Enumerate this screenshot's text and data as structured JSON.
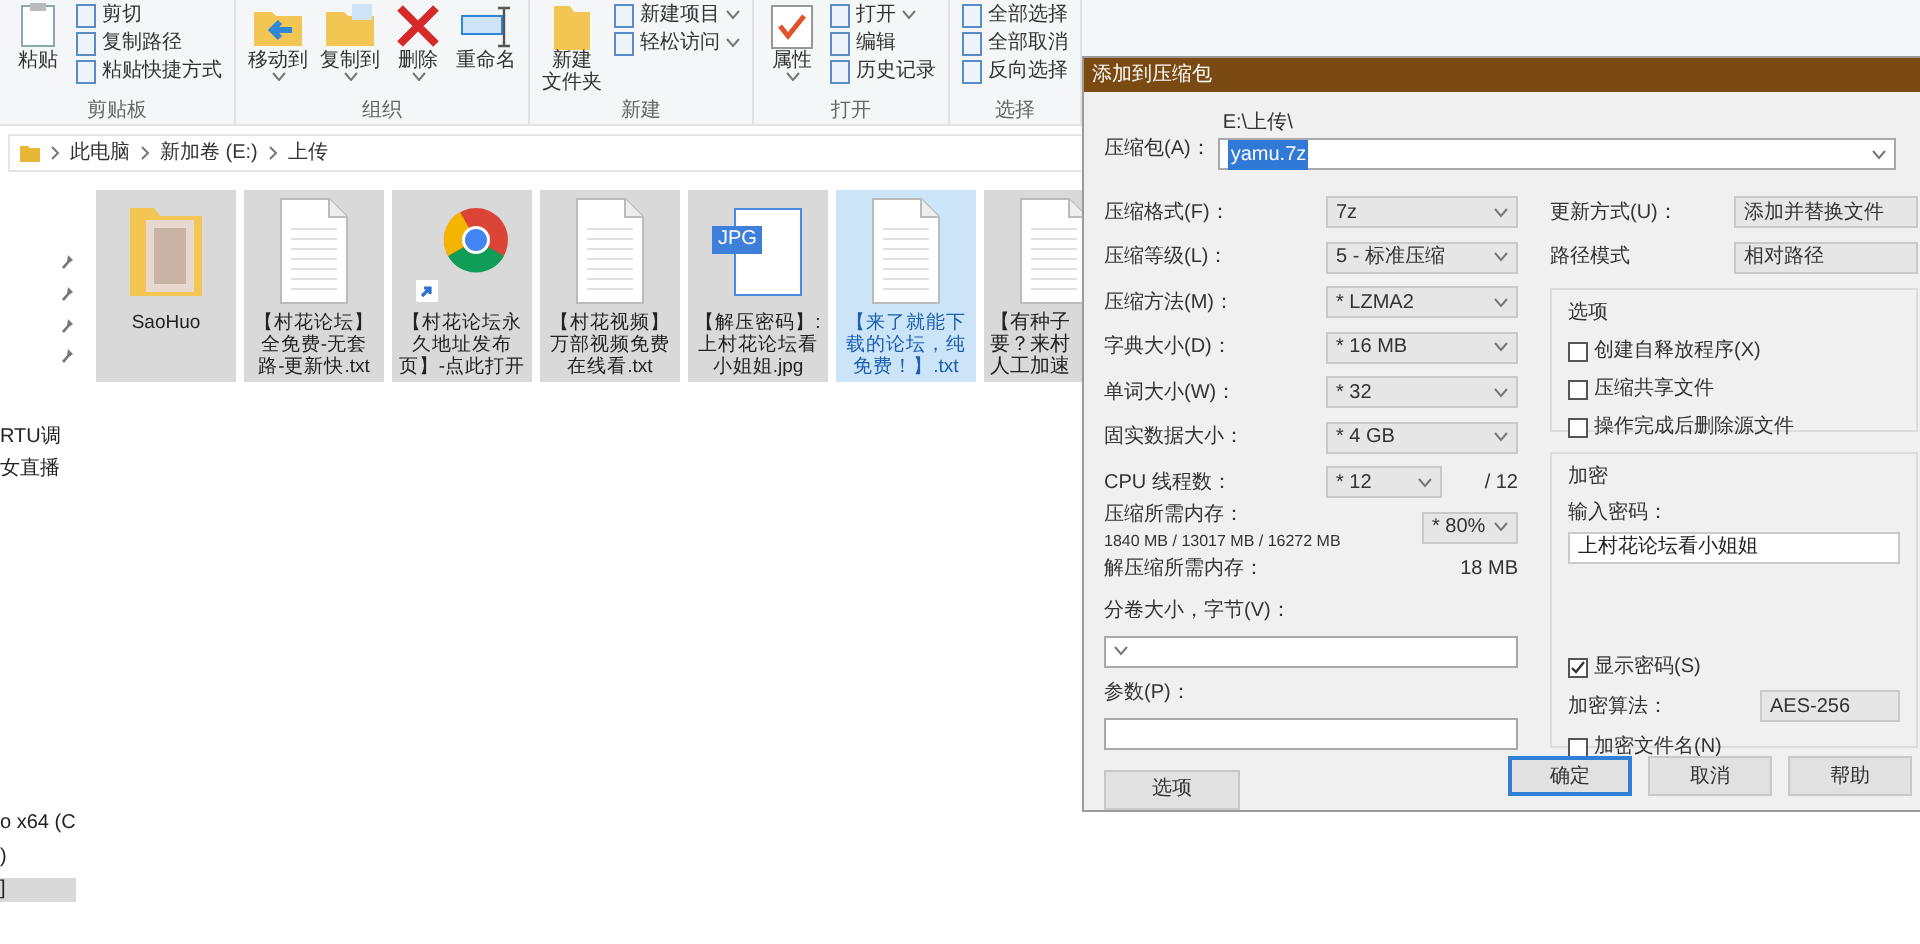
{
  "ribbon": {
    "groups": [
      {
        "label": "剪贴板",
        "items": [
          {
            "label": "粘贴",
            "kind": "large",
            "dropdown": false
          },
          {
            "label": "剪切",
            "kind": "small",
            "dropdown": false
          },
          {
            "label": "复制路径",
            "kind": "small",
            "dropdown": false
          },
          {
            "label": "粘贴快捷方式",
            "kind": "small",
            "dropdown": false
          }
        ]
      },
      {
        "label": "组织",
        "items": [
          {
            "label": "移动到",
            "kind": "large",
            "dropdown": true
          },
          {
            "label": "复制到",
            "kind": "large",
            "dropdown": true
          },
          {
            "label": "删除",
            "kind": "large",
            "dropdown": true
          },
          {
            "label": "重命名",
            "kind": "large",
            "dropdown": false
          }
        ]
      },
      {
        "label": "新建",
        "items": [
          {
            "lines": [
              "新建",
              "文件夹"
            ],
            "kind": "large",
            "dropdown": false
          },
          {
            "label": "新建项目",
            "kind": "small",
            "dropdown": true
          },
          {
            "label": "轻松访问",
            "kind": "small",
            "dropdown": true
          }
        ]
      },
      {
        "label": "打开",
        "items": [
          {
            "label": "属性",
            "kind": "large",
            "dropdown": true
          },
          {
            "label": "打开",
            "kind": "small",
            "dropdown": true
          },
          {
            "label": "编辑",
            "kind": "small",
            "dropdown": false
          },
          {
            "label": "历史记录",
            "kind": "small",
            "dropdown": false
          }
        ]
      },
      {
        "label": "选择",
        "items": [
          {
            "label": "全部选择",
            "kind": "small",
            "dropdown": false
          },
          {
            "label": "全部取消",
            "kind": "small",
            "dropdown": false
          },
          {
            "label": "反向选择",
            "kind": "small",
            "dropdown": false
          }
        ]
      }
    ]
  },
  "breadcrumb": [
    "此电脑",
    "新加卷 (E:)",
    "上传"
  ],
  "nav_items": [
    {
      "label": "RTU调",
      "selected": false
    },
    {
      "label": "女直播",
      "selected": false
    },
    {
      "label": "o x64 (C",
      "selected": false
    },
    {
      "label": ")",
      "selected": false
    },
    {
      "label": "]",
      "selected": true
    }
  ],
  "files": [
    {
      "name": "SaoHuo",
      "kind": "folder",
      "selected": false
    },
    {
      "name": "【村花论坛】全免费-无套路-更新快.txt",
      "kind": "text",
      "selected": false
    },
    {
      "name": "【村花论坛永久地址发布页】-点此打开",
      "kind": "shortcut",
      "selected": false
    },
    {
      "name": "【村花视频】万部视频免费在线看.txt",
      "kind": "text",
      "selected": false
    },
    {
      "name": "【解压密码】:上村花论坛看小姐姐.jpg",
      "kind": "image",
      "badge": "JPG",
      "selected": false
    },
    {
      "name": "【来了就能下载的论坛，纯免费！】.txt",
      "kind": "text",
      "selected": true
    },
    {
      "name": "【有种子要？来村人工加速",
      "kind": "text",
      "selected": false
    }
  ],
  "dialog": {
    "title": "添加到压缩包",
    "archive": {
      "label": "压缩包(A)：",
      "path": "E:\\上传\\",
      "value": "yamu.7z",
      "highlighted": true
    },
    "left_rows": [
      {
        "kind": "combo",
        "label": "压缩格式(F)：",
        "value": "7z"
      },
      {
        "kind": "combo",
        "label": "压缩等级(L)：",
        "value": "5 - 标准压缩"
      },
      {
        "kind": "combo",
        "label": "压缩方法(M)：",
        "value": "* LZMA2"
      },
      {
        "kind": "combo",
        "label": "字典大小(D)：",
        "value": "* 16 MB"
      },
      {
        "kind": "combo",
        "label": "单词大小(W)：",
        "value": "* 32"
      },
      {
        "kind": "combo",
        "label": "固实数据大小：",
        "value": "* 4 GB"
      },
      {
        "kind": "threads",
        "label": "CPU 线程数：",
        "value": "* 12",
        "suffix": "/ 12"
      },
      {
        "kind": "memory",
        "label": "压缩所需内存：",
        "detail": "1840 MB / 13017 MB / 16272 MB",
        "value": "* 80%"
      },
      {
        "kind": "info",
        "label": "解压缩所需内存：",
        "value": "18 MB"
      },
      {
        "kind": "stacked_combo",
        "label": "分卷大小，字节(V)："
      },
      {
        "kind": "stacked_input",
        "label": "参数(P)："
      }
    ],
    "options_button": "选项",
    "right_rows": [
      {
        "label": "更新方式(U)：",
        "value": "添加并替换文件"
      },
      {
        "label": "路径模式",
        "value": "相对路径"
      }
    ],
    "options_group": {
      "title": "选项",
      "checks": [
        {
          "label": "创建自释放程序(X)",
          "checked": false
        },
        {
          "label": "压缩共享文件",
          "checked": false
        },
        {
          "label": "操作完成后删除源文件",
          "checked": false
        }
      ]
    },
    "encryption": {
      "title": "加密",
      "password_label": "输入密码：",
      "password": "上村花论坛看小姐姐",
      "show_password": {
        "label": "显示密码(S)",
        "checked": true
      },
      "algorithm_label": "加密算法：",
      "algorithm": "AES-256",
      "encrypt_names": {
        "label": "加密文件名(N)",
        "checked": false
      }
    },
    "buttons": [
      {
        "label": "确定",
        "default": true
      },
      {
        "label": "取消",
        "default": false
      },
      {
        "label": "帮助",
        "default": false
      }
    ]
  }
}
